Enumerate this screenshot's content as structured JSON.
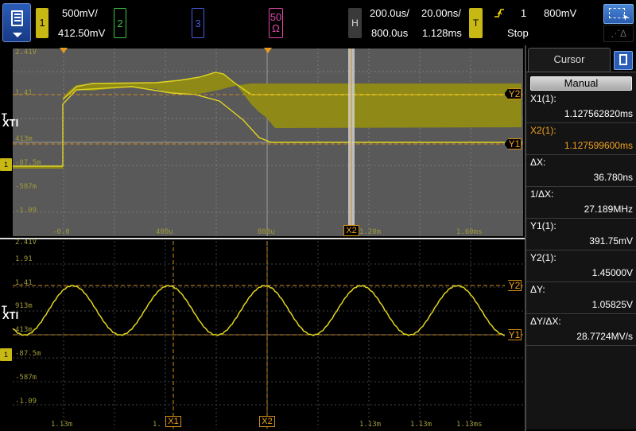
{
  "topbar": {
    "ch1": {
      "num": "1",
      "scale": "500mV/",
      "offset": "412.50mV",
      "color": "#c8b814"
    },
    "ch2": {
      "num": "2",
      "color": "#3ec43e"
    },
    "ch3": {
      "num": "3",
      "color": "#4a5adf"
    },
    "ch4": {
      "num": "50",
      "impedance": "Ω",
      "color": "#e04aa8"
    },
    "horizontal": {
      "label": "H",
      "main_scale": "200.0us/",
      "zoom_scale": "20.00ns/",
      "main_pos": "800.0us",
      "zoom_pos": "1.128ms"
    },
    "trigger": {
      "label": "T",
      "source": "1",
      "level": "800mV",
      "state": "Stop"
    },
    "icons": {
      "menu": "menu-icon",
      "zoom": "zoom-select-icon",
      "delta": "delta-icon",
      "edge": "rising-edge-icon"
    }
  },
  "top_screen": {
    "levels": [
      "2.41V",
      "1.41",
      "413m",
      "-87.5m",
      "-587m",
      "-1.09"
    ],
    "time_labels": [
      "-0.0",
      "400u",
      "800u",
      "1.20m",
      "1.60ms"
    ],
    "ch1_marker": "1",
    "trig_marker": "T",
    "xti_label": "XTI",
    "y2_label": "Y2",
    "y1_label": "Y1",
    "x2_label": "X2"
  },
  "bottom_screen": {
    "levels": [
      "2.41V",
      "1.91",
      "1.41",
      "913m",
      "413m",
      "-87.5m",
      "-587m",
      "-1.09"
    ],
    "time_labels": [
      "1.13m",
      "1.",
      "1.13m",
      "1.13m",
      "1.13ms"
    ],
    "ch1_marker": "1",
    "trig_marker": "T",
    "xti_label": "XTI",
    "y2_label": "Y2",
    "y1_label": "Y1",
    "x1_label": "X1",
    "x2_label": "X2"
  },
  "panel": {
    "tab_label": "Cursor",
    "mode": "Manual",
    "rows": [
      {
        "label": "X1(1):",
        "value": "1.127562820ms"
      },
      {
        "label": "X2(1):",
        "value": "1.127599600ms"
      },
      {
        "label": "ΔX:",
        "value": "36.780ns"
      },
      {
        "label": "1/ΔX:",
        "value": "27.189MHz"
      },
      {
        "label": "Y1(1):",
        "value": "391.75mV"
      },
      {
        "label": "Y2(1):",
        "value": "1.45000V"
      },
      {
        "label": "ΔY:",
        "value": "1.05825V"
      },
      {
        "label": "ΔY/ΔX:",
        "value": "28.7724MV/s"
      }
    ]
  },
  "colors": {
    "trace": "#d8cf1c",
    "cursor": "#d08c1a",
    "grid": "#777777"
  }
}
